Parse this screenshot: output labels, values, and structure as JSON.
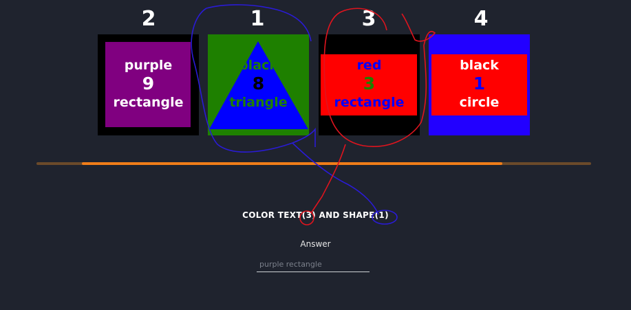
{
  "cards": [
    {
      "number": "2",
      "word1": "purple",
      "word2": "9",
      "word3": "rectangle",
      "outer_color": "#000000",
      "inner_color": "#800080",
      "shape": "rectangle",
      "text_colors": [
        "#ffffff",
        "#ffffff",
        "#ffffff"
      ]
    },
    {
      "number": "1",
      "word1": "black",
      "word2": "8",
      "word3": "triangle",
      "outer_color": "#1e8000",
      "inner_color": "#0000ff",
      "shape": "triangle",
      "text_colors": [
        "#1e8000",
        "#000000",
        "#1e8000"
      ]
    },
    {
      "number": "3",
      "word1": "red",
      "word2": "3",
      "word3": "rectangle",
      "outer_color": "#000000",
      "inner_color": "#ff0000",
      "shape": "rectangle",
      "text_colors": [
        "#0000ff",
        "#1e8000",
        "#0000ff"
      ]
    },
    {
      "number": "4",
      "word1": "black",
      "word2": "1",
      "word3": "circle",
      "outer_color": "#2200ff",
      "inner_color": "#ff0000",
      "shape": "rectangle",
      "text_colors": [
        "#ffffff",
        "#0000ff",
        "#ffffff"
      ]
    }
  ],
  "progress": {
    "fraction": 0.84,
    "fill_color": "#f07d19",
    "track_color": "#6b4a2a"
  },
  "instruction": "COLOR TEXT(3) AND SHAPE(1)",
  "answer": {
    "label": "Answer",
    "placeholder": "purple rectangle",
    "value": ""
  }
}
